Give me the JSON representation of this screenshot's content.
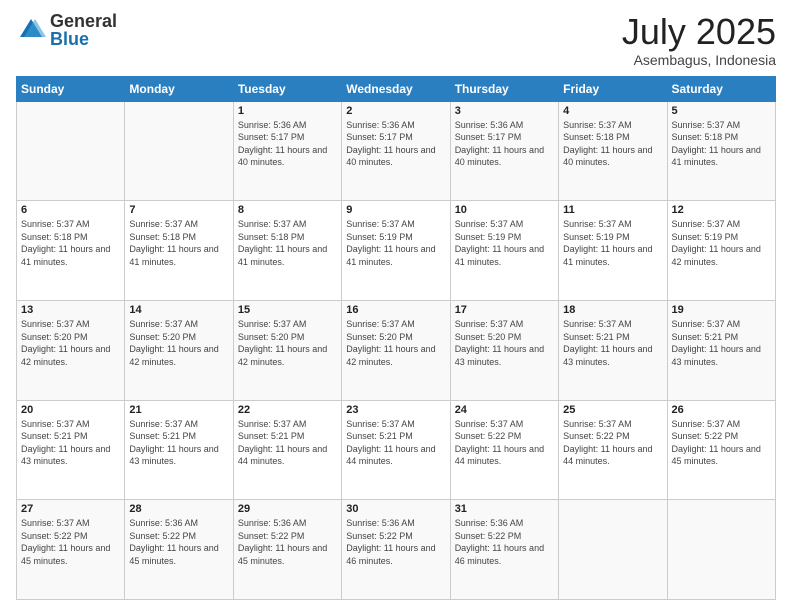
{
  "logo": {
    "general": "General",
    "blue": "Blue"
  },
  "header": {
    "month": "July 2025",
    "location": "Asembagus, Indonesia"
  },
  "weekdays": [
    "Sunday",
    "Monday",
    "Tuesday",
    "Wednesday",
    "Thursday",
    "Friday",
    "Saturday"
  ],
  "weeks": [
    [
      {
        "day": "",
        "info": ""
      },
      {
        "day": "",
        "info": ""
      },
      {
        "day": "1",
        "info": "Sunrise: 5:36 AM\nSunset: 5:17 PM\nDaylight: 11 hours and 40 minutes."
      },
      {
        "day": "2",
        "info": "Sunrise: 5:36 AM\nSunset: 5:17 PM\nDaylight: 11 hours and 40 minutes."
      },
      {
        "day": "3",
        "info": "Sunrise: 5:36 AM\nSunset: 5:17 PM\nDaylight: 11 hours and 40 minutes."
      },
      {
        "day": "4",
        "info": "Sunrise: 5:37 AM\nSunset: 5:18 PM\nDaylight: 11 hours and 40 minutes."
      },
      {
        "day": "5",
        "info": "Sunrise: 5:37 AM\nSunset: 5:18 PM\nDaylight: 11 hours and 41 minutes."
      }
    ],
    [
      {
        "day": "6",
        "info": "Sunrise: 5:37 AM\nSunset: 5:18 PM\nDaylight: 11 hours and 41 minutes."
      },
      {
        "day": "7",
        "info": "Sunrise: 5:37 AM\nSunset: 5:18 PM\nDaylight: 11 hours and 41 minutes."
      },
      {
        "day": "8",
        "info": "Sunrise: 5:37 AM\nSunset: 5:18 PM\nDaylight: 11 hours and 41 minutes."
      },
      {
        "day": "9",
        "info": "Sunrise: 5:37 AM\nSunset: 5:19 PM\nDaylight: 11 hours and 41 minutes."
      },
      {
        "day": "10",
        "info": "Sunrise: 5:37 AM\nSunset: 5:19 PM\nDaylight: 11 hours and 41 minutes."
      },
      {
        "day": "11",
        "info": "Sunrise: 5:37 AM\nSunset: 5:19 PM\nDaylight: 11 hours and 41 minutes."
      },
      {
        "day": "12",
        "info": "Sunrise: 5:37 AM\nSunset: 5:19 PM\nDaylight: 11 hours and 42 minutes."
      }
    ],
    [
      {
        "day": "13",
        "info": "Sunrise: 5:37 AM\nSunset: 5:20 PM\nDaylight: 11 hours and 42 minutes."
      },
      {
        "day": "14",
        "info": "Sunrise: 5:37 AM\nSunset: 5:20 PM\nDaylight: 11 hours and 42 minutes."
      },
      {
        "day": "15",
        "info": "Sunrise: 5:37 AM\nSunset: 5:20 PM\nDaylight: 11 hours and 42 minutes."
      },
      {
        "day": "16",
        "info": "Sunrise: 5:37 AM\nSunset: 5:20 PM\nDaylight: 11 hours and 42 minutes."
      },
      {
        "day": "17",
        "info": "Sunrise: 5:37 AM\nSunset: 5:20 PM\nDaylight: 11 hours and 43 minutes."
      },
      {
        "day": "18",
        "info": "Sunrise: 5:37 AM\nSunset: 5:21 PM\nDaylight: 11 hours and 43 minutes."
      },
      {
        "day": "19",
        "info": "Sunrise: 5:37 AM\nSunset: 5:21 PM\nDaylight: 11 hours and 43 minutes."
      }
    ],
    [
      {
        "day": "20",
        "info": "Sunrise: 5:37 AM\nSunset: 5:21 PM\nDaylight: 11 hours and 43 minutes."
      },
      {
        "day": "21",
        "info": "Sunrise: 5:37 AM\nSunset: 5:21 PM\nDaylight: 11 hours and 43 minutes."
      },
      {
        "day": "22",
        "info": "Sunrise: 5:37 AM\nSunset: 5:21 PM\nDaylight: 11 hours and 44 minutes."
      },
      {
        "day": "23",
        "info": "Sunrise: 5:37 AM\nSunset: 5:21 PM\nDaylight: 11 hours and 44 minutes."
      },
      {
        "day": "24",
        "info": "Sunrise: 5:37 AM\nSunset: 5:22 PM\nDaylight: 11 hours and 44 minutes."
      },
      {
        "day": "25",
        "info": "Sunrise: 5:37 AM\nSunset: 5:22 PM\nDaylight: 11 hours and 44 minutes."
      },
      {
        "day": "26",
        "info": "Sunrise: 5:37 AM\nSunset: 5:22 PM\nDaylight: 11 hours and 45 minutes."
      }
    ],
    [
      {
        "day": "27",
        "info": "Sunrise: 5:37 AM\nSunset: 5:22 PM\nDaylight: 11 hours and 45 minutes."
      },
      {
        "day": "28",
        "info": "Sunrise: 5:36 AM\nSunset: 5:22 PM\nDaylight: 11 hours and 45 minutes."
      },
      {
        "day": "29",
        "info": "Sunrise: 5:36 AM\nSunset: 5:22 PM\nDaylight: 11 hours and 45 minutes."
      },
      {
        "day": "30",
        "info": "Sunrise: 5:36 AM\nSunset: 5:22 PM\nDaylight: 11 hours and 46 minutes."
      },
      {
        "day": "31",
        "info": "Sunrise: 5:36 AM\nSunset: 5:22 PM\nDaylight: 11 hours and 46 minutes."
      },
      {
        "day": "",
        "info": ""
      },
      {
        "day": "",
        "info": ""
      }
    ]
  ]
}
